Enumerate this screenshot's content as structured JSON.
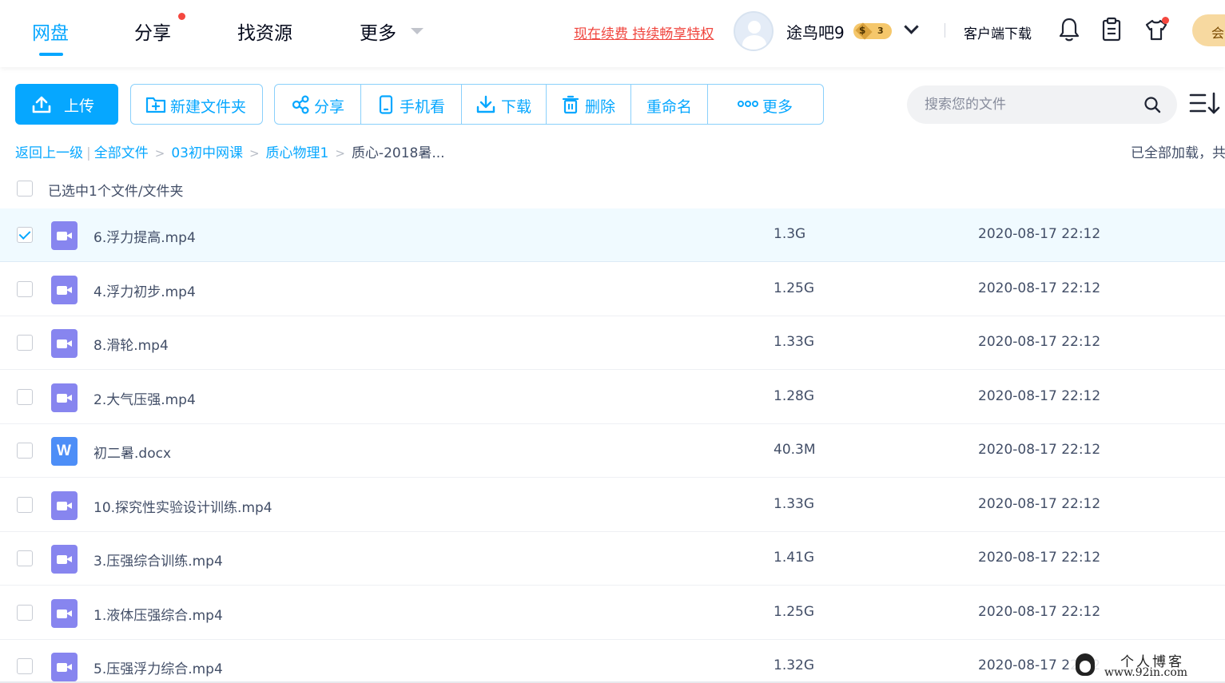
{
  "nav": {
    "tabs": [
      {
        "label": "网盘",
        "active": true
      },
      {
        "label": "分享",
        "has_dot": true
      },
      {
        "label": "找资源"
      },
      {
        "label": "更多",
        "has_dropdown": true
      }
    ],
    "renew_link": "现在续费 持续畅享特权",
    "username": "途鸟吧9",
    "vip_level": "3",
    "vip_symbol": "$",
    "client_download": "客户端下载",
    "member_label": "会",
    "icons": [
      "bell-icon",
      "clipboard-icon",
      "tshirt-icon"
    ]
  },
  "toolbar": {
    "upload": "上传",
    "new_folder": "新建文件夹",
    "share": "分享",
    "mobile_view": "手机看",
    "download": "下载",
    "delete": "删除",
    "rename": "重命名",
    "more": "更多",
    "search_placeholder": "搜索您的文件"
  },
  "breadcrumb": {
    "back": "返回上一级",
    "items": [
      "全部文件",
      "03初中网课",
      "质心物理1"
    ],
    "current": "质心-2018暑...",
    "load_status": "已全部加载，共"
  },
  "selection": {
    "summary": "已选中1个文件/文件夹"
  },
  "files": [
    {
      "name": "6.浮力提高.mp4",
      "size": "1.3G",
      "time": "2020-08-17 22:12",
      "type": "video",
      "selected": true
    },
    {
      "name": "4.浮力初步.mp4",
      "size": "1.25G",
      "time": "2020-08-17 22:12",
      "type": "video",
      "selected": false
    },
    {
      "name": "8.滑轮.mp4",
      "size": "1.33G",
      "time": "2020-08-17 22:12",
      "type": "video",
      "selected": false
    },
    {
      "name": "2.大气压强.mp4",
      "size": "1.28G",
      "time": "2020-08-17 22:12",
      "type": "video",
      "selected": false
    },
    {
      "name": "初二暑.docx",
      "size": "40.3M",
      "time": "2020-08-17 22:12",
      "type": "doc",
      "selected": false
    },
    {
      "name": "10.探究性实验设计训练.mp4",
      "size": "1.33G",
      "time": "2020-08-17 22:12",
      "type": "video",
      "selected": false
    },
    {
      "name": "3.压强综合训练.mp4",
      "size": "1.41G",
      "time": "2020-08-17 22:12",
      "type": "video",
      "selected": false
    },
    {
      "name": "1.液体压强综合.mp4",
      "size": "1.25G",
      "time": "2020-08-17 22:12",
      "type": "video",
      "selected": false
    },
    {
      "name": "5.压强浮力综合.mp4",
      "size": "1.32G",
      "time": "2020-08-17 22:12",
      "type": "video",
      "selected": false
    }
  ],
  "watermark": {
    "title": "个人博客",
    "url": "www.92in.com"
  },
  "colors": {
    "accent": "#06a7ff",
    "renew": "#f0463f",
    "video_icon": "#8785ef",
    "doc_icon": "#4d8ef7"
  }
}
